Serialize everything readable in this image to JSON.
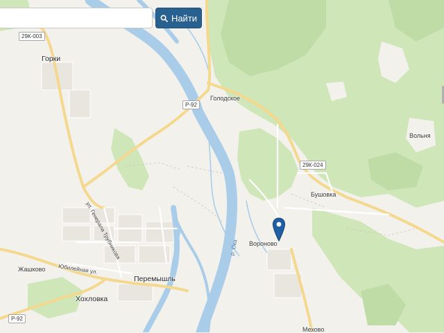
{
  "search": {
    "placeholder": "",
    "value": "",
    "button_label": "Найти",
    "button_color": "#286090"
  },
  "map": {
    "colors": {
      "background": "#f3f1ec",
      "forest": "#cfe6b8",
      "forest_dark": "#bfdca6",
      "water": "#a9cde9",
      "road_major": "#f3d88e",
      "road_minor": "#ffffff",
      "pin": "#1f5fa6"
    },
    "places": {
      "gorki": "Горки",
      "golodskoe": "Голодское",
      "volnya": "Вольня",
      "bushovka": "Бушовка",
      "voronovo": "Вороново",
      "zhashkovo": "Жашково",
      "peremyshl": "Перемышль",
      "kholovka": "Хохловка",
      "mekhovo": "Мехово"
    },
    "streets": {
      "trubnikova": "ул. Генерала Трубникова",
      "yubileynaya": "Юбилейная ул."
    },
    "river": "р. Ока",
    "road_shields": {
      "r29k003": "29К-003",
      "p92_top": "Р-92",
      "r29k024": "29К-024",
      "p92_bottom": "Р-92"
    },
    "marker_icon": "map-pin-icon"
  }
}
